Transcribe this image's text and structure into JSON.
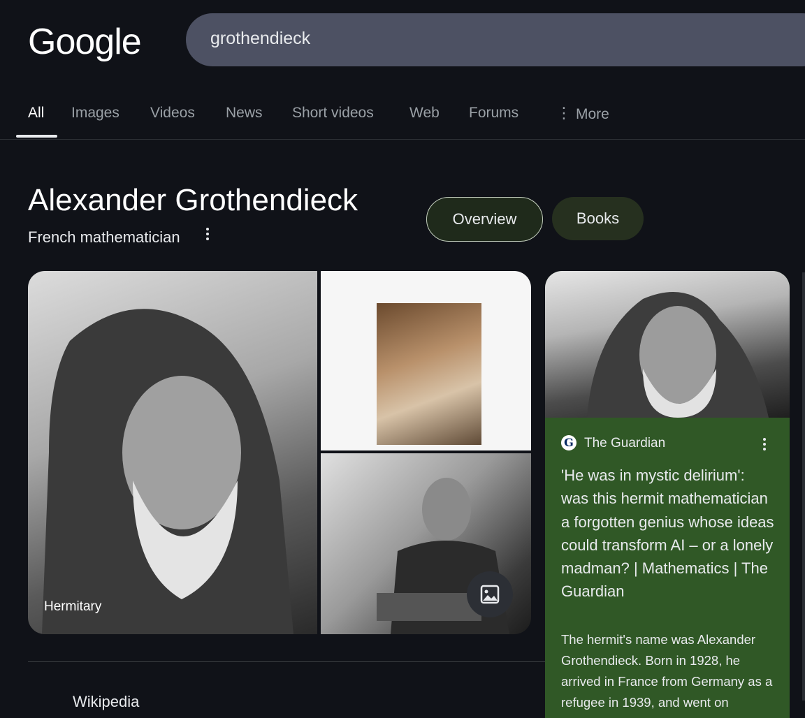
{
  "logo": "Google",
  "search": {
    "query": "grothendieck"
  },
  "tabs": [
    {
      "label": "All"
    },
    {
      "label": "Images"
    },
    {
      "label": "Videos"
    },
    {
      "label": "News"
    },
    {
      "label": "Short videos"
    },
    {
      "label": "Web"
    },
    {
      "label": "Forums"
    },
    {
      "label": "More"
    }
  ],
  "entity": {
    "title": "Alexander Grothendieck",
    "subtitle": "French mathematician",
    "chips": [
      "Overview",
      "Books"
    ]
  },
  "images": {
    "caption": "Hermitary"
  },
  "article": {
    "source": "The Guardian",
    "source_logo": "G",
    "headline": "'He was in mystic delirium': was this hermit mathematician a forgotten genius whose ideas could transform AI – or a lonely madman? | Mathematics | The Guardian",
    "snippet": "The hermit's name was Alexander Grothendieck. Born in 1928, he arrived in France from Germany as a refugee in 1939, and went on"
  },
  "next_result": "Wikipedia",
  "colors": {
    "background": "#101218",
    "card": "#305826",
    "search": "#4d5163"
  }
}
